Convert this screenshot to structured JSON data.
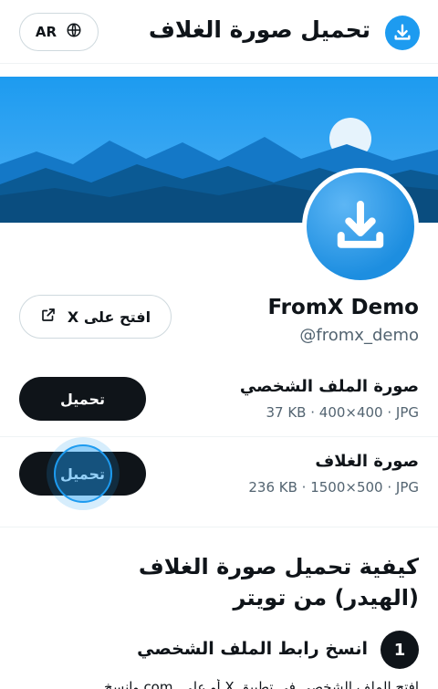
{
  "header": {
    "title": "تحميل صورة الغلاف",
    "lang_label": "AR",
    "logo_icon": "download-icon",
    "lang_icon": "globe-icon"
  },
  "colors": {
    "accent": "#1d9bf0",
    "dark": "#0f1419",
    "muted": "#536471",
    "border": "#cfd9de"
  },
  "profile": {
    "display_name": "FromX Demo",
    "handle": "@fromx_demo",
    "open_button_label": "افتح على X",
    "open_icon": "external-link-icon"
  },
  "downloads": [
    {
      "title": "صورة الملف الشخصي",
      "meta": "37 KB · 400×400 · JPG",
      "button_label": "تحميل"
    },
    {
      "title": "صورة الغلاف",
      "meta": "236 KB · 1500×500 · JPG",
      "button_label": "تحميل"
    }
  ],
  "howto": {
    "title": "كيفية تحميل صورة الغلاف (الهيدر) من تويتر",
    "steps": [
      {
        "number": "1",
        "title": "انسخ رابط الملف الشخصي",
        "text": "افتح الملف الشخصي في تطبيق X أو على .com وانسخ"
      }
    ]
  }
}
